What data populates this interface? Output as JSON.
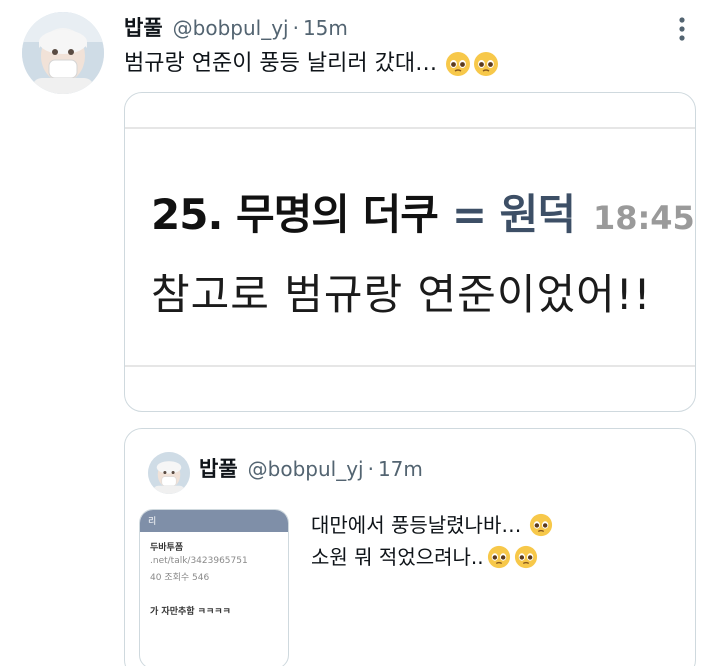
{
  "tweet": {
    "author_name": "밥풀",
    "handle": "@bobpul_yj",
    "separator": "·",
    "time": "15m",
    "text": "범규랑 연준이 풍등 날리러 갔대…",
    "emoji": "pleading-face-emoji",
    "more_icon": "more-vertical-icon"
  },
  "media": {
    "line1_main": "25. 무명의 더쿠",
    "line1_accent": "= 원덕",
    "line1_time": "18:45",
    "line2": "참고로 범규랑 연준이었어!!",
    "accent_color": "#3d4f66"
  },
  "quote": {
    "author_name": "밥풀",
    "handle": "@bobpul_yj",
    "separator": "·",
    "time": "17m",
    "lines": [
      "대만에서 풍등날렸나바…",
      "소원 뭐 적었으려나.."
    ],
    "thumb": {
      "header": "리",
      "line1": "두바투폼",
      "line2": ".net/talk/3423965751",
      "line3": "40  조회수 546",
      "line4": "가 자만추함 ㅋㅋㅋㅋ"
    }
  },
  "colors": {
    "text": "#0f1419",
    "muted": "#536471",
    "border": "#cfd9de"
  }
}
